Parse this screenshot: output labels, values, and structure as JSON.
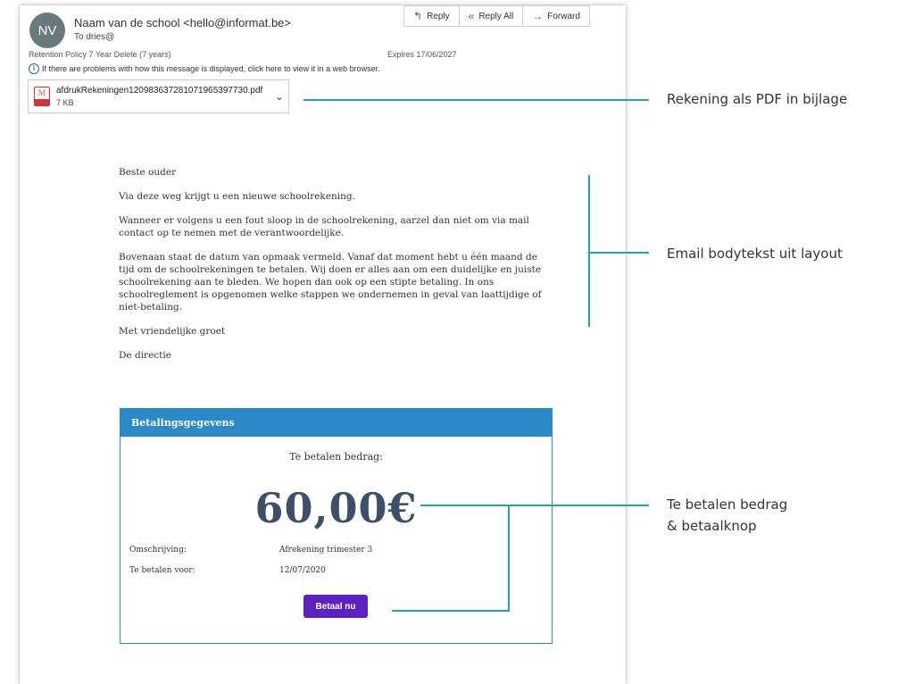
{
  "email": {
    "avatar_initials": "NV",
    "from": "Naam van de school <hello@informat.be>",
    "to": "To  dries@",
    "retention": "Retention Policy  7 Year Delete (7 years)",
    "expires": "Expires  17/06/2027",
    "info_message": "If there are problems with how this message is displayed, click here to view it in a web browser.",
    "actions": [
      {
        "label": "Reply",
        "icon": "reply-icon",
        "glyph": "↰"
      },
      {
        "label": "Reply All",
        "icon": "reply-all-icon",
        "glyph": "«"
      },
      {
        "label": "Forward",
        "icon": "forward-icon",
        "glyph": "→"
      }
    ],
    "attachment": {
      "name": "afdrukRekeningen120983637281071965397730.pdf",
      "size": "7 KB",
      "icon": "pdf-file-icon"
    }
  },
  "body": {
    "greeting": "Beste ouder",
    "p1": "Via deze weg krijgt u een nieuwe schoolrekening.",
    "p2": "Wanneer er volgens u een fout sloop in de schoolrekening, aarzel dan niet om via mail contact op te nemen met de verantwoordelijke.",
    "p3": "Bovenaan staat de datum van opmaak vermeld. Vanaf dat moment hebt u één maand de tijd om de schoolrekeningen te betalen. Wij doen er alles aan om een duidelijke en juiste schoolrekening aan te bleden. We hopen dan ook op een stipte betaling. In ons schoolreglement is opgenomen welke stappen we ondernemen in geval van laattijdige of niet-betaling.",
    "closing": "Met vriendelijke groet",
    "signature": "De directie"
  },
  "payment": {
    "header": "Betalingsgegevens",
    "amount_label": "Te betalen bedrag:",
    "amount": "60,00€",
    "description_label": "Omschrijving:",
    "description_value": "Afrekening trimester 3",
    "due_label": "Te betalen voor:",
    "due_value": "12/07/2020",
    "pay_button": "Betaal nu",
    "header_color": "#2a8ac8",
    "button_color": "#5b21c2"
  },
  "annotations": {
    "attachment": "Rekening als PDF in bijlage",
    "body": "Email bodytekst uit layout",
    "amount_line1": "Te betalen bedrag",
    "amount_line2": "& betaalknop",
    "line_color": "#26a79b"
  }
}
